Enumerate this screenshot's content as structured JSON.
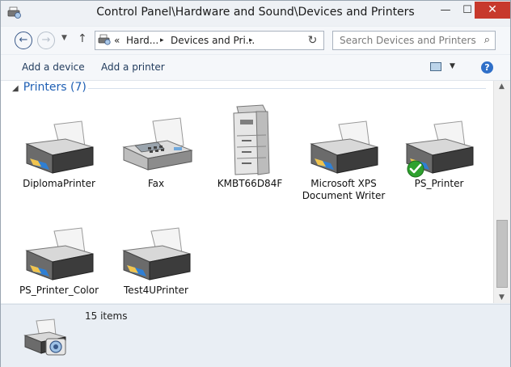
{
  "window": {
    "title": "Control Panel\\Hardware and Sound\\Devices and Printers",
    "minimize": "—",
    "maximize": "☐",
    "close": "✕"
  },
  "nav": {
    "back": "←",
    "forward": "→",
    "recent": "▼",
    "up": "↑",
    "address_prefix": "«",
    "address_seg1": "Hard...",
    "address_seg2": "Devices and Pri...",
    "address_chevron": "▸",
    "refresh": "↻",
    "search_placeholder": "Search Devices and Printers",
    "search_icon": "⌕"
  },
  "toolbar": {
    "add_device": "Add a device",
    "add_printer": "Add a printer",
    "view_drop": "▼",
    "help": "?"
  },
  "group": {
    "arrow": "◢",
    "label": "Printers (7)"
  },
  "printers": [
    {
      "label": "DiplomaPrinter",
      "icon": "printer-icon",
      "default": false
    },
    {
      "label": "Fax",
      "icon": "fax-icon",
      "default": false
    },
    {
      "label": "KMBT66D84F",
      "icon": "copier-icon",
      "default": false
    },
    {
      "label": "Microsoft XPS Document Writer",
      "icon": "printer-icon",
      "default": false
    },
    {
      "label": "PS_Printer",
      "icon": "printer-icon",
      "default": true
    },
    {
      "label": "PS_Printer_Color",
      "icon": "printer-icon",
      "default": false
    },
    {
      "label": "Test4UPrinter",
      "icon": "printer-icon",
      "default": false
    }
  ],
  "details": {
    "count": "15 items"
  },
  "colors": {
    "accent": "#1e5fb4",
    "close": "#c7392c",
    "default_check": "#2ea12e"
  }
}
